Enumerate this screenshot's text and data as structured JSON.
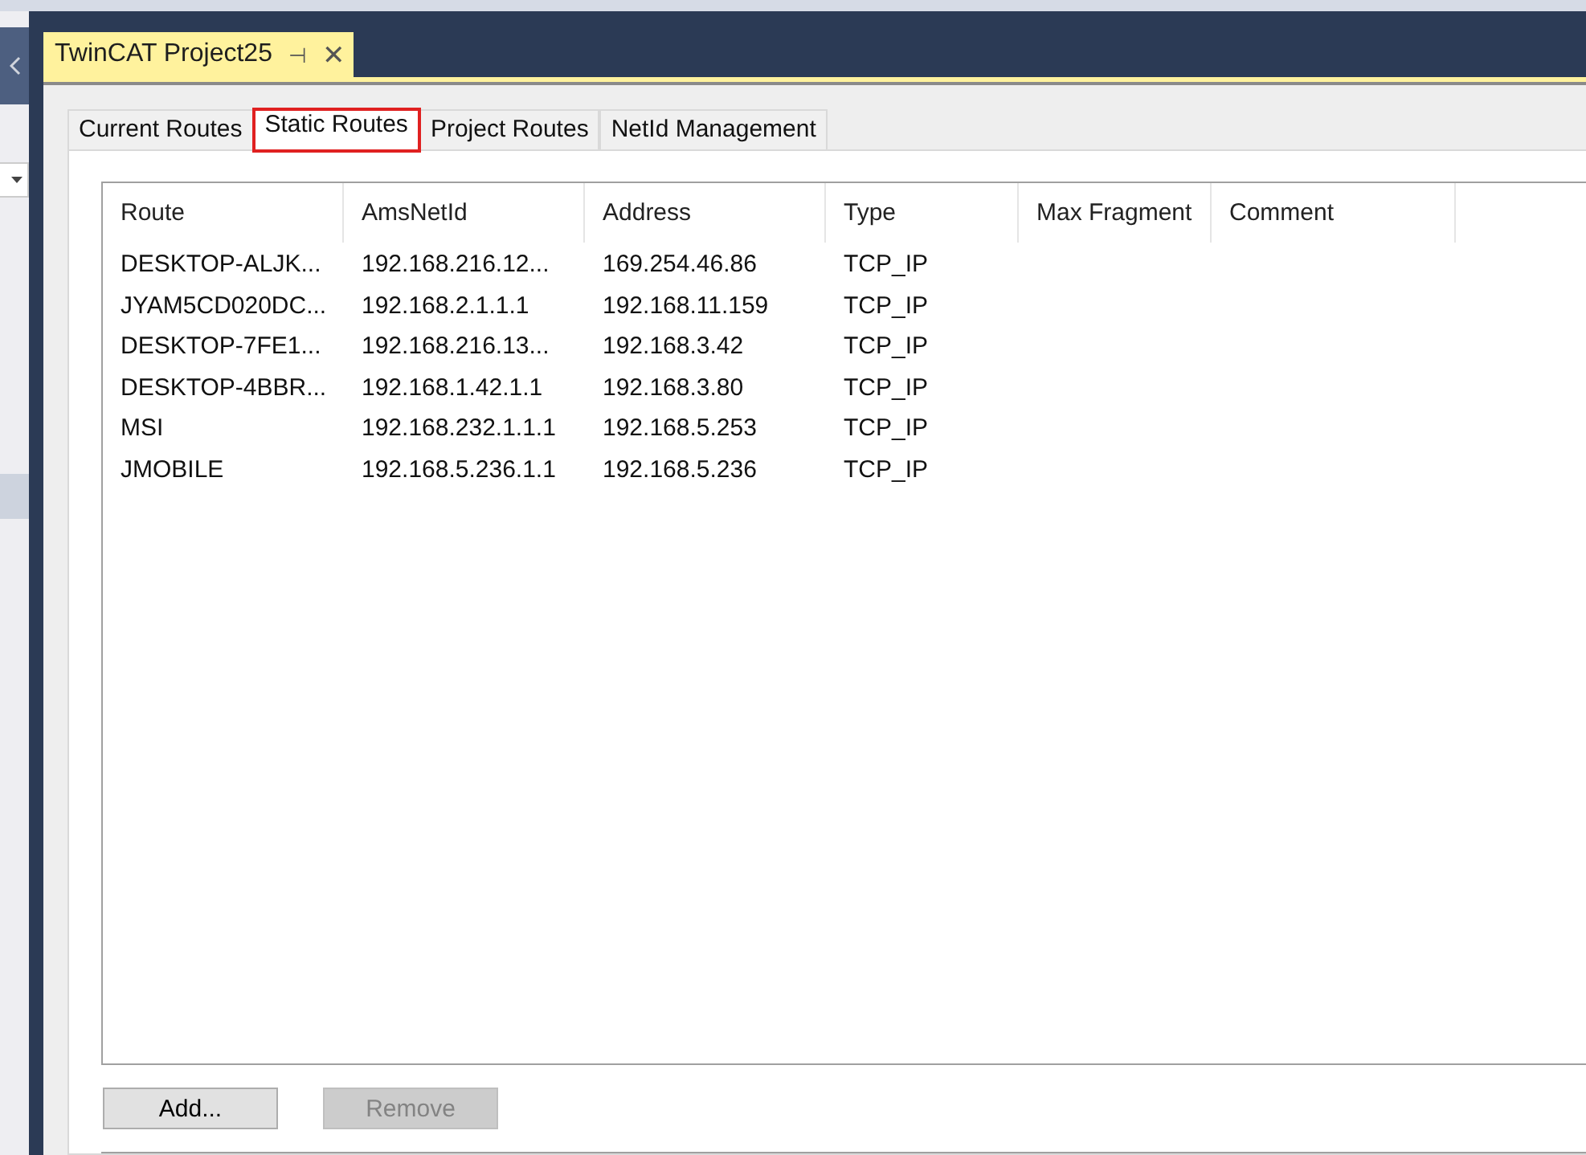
{
  "document_tab": {
    "title": "TwinCAT Project25",
    "pin_glyph": "⊣",
    "close_glyph": "✕"
  },
  "tabs": [
    {
      "label": "Current Routes",
      "selected": false,
      "highlighted": false
    },
    {
      "label": "Static Routes",
      "selected": true,
      "highlighted": true
    },
    {
      "label": "Project Routes",
      "selected": false,
      "highlighted": false
    },
    {
      "label": "NetId Management",
      "selected": false,
      "highlighted": false
    }
  ],
  "table": {
    "columns": [
      "Route",
      "AmsNetId",
      "Address",
      "Type",
      "Max Fragment",
      "Comment"
    ],
    "rows": [
      [
        "DESKTOP-ALJK...",
        "192.168.216.12...",
        "169.254.46.86",
        "TCP_IP"
      ],
      [
        "JYAM5CD020DC...",
        "192.168.2.1.1.1",
        "192.168.11.159",
        "TCP_IP"
      ],
      [
        "DESKTOP-7FE1...",
        "192.168.216.13...",
        "192.168.3.42",
        "TCP_IP"
      ],
      [
        "DESKTOP-4BBR...",
        "192.168.1.42.1.1",
        "192.168.3.80",
        "TCP_IP"
      ],
      [
        "MSI",
        "192.168.232.1.1.1",
        "192.168.5.253",
        "TCP_IP"
      ],
      [
        "JMOBILE",
        "192.168.5.236.1.1",
        "192.168.5.236",
        "TCP_IP"
      ]
    ]
  },
  "buttons": [
    {
      "label": "Add...",
      "disabled": false
    },
    {
      "label": "Remove",
      "disabled": true
    }
  ]
}
